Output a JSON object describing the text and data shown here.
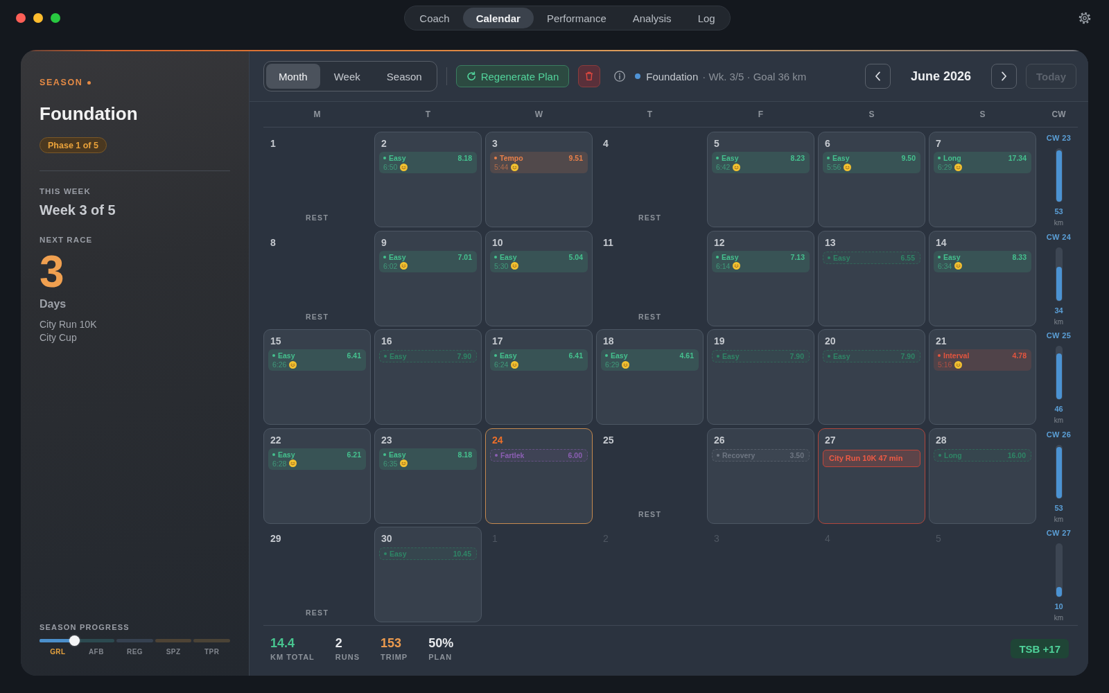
{
  "nav": {
    "tabs": [
      {
        "label": "Coach",
        "selected": false
      },
      {
        "label": "Calendar",
        "selected": true
      },
      {
        "label": "Performance",
        "selected": false
      },
      {
        "label": "Analysis",
        "selected": false
      },
      {
        "label": "Log",
        "selected": false
      }
    ]
  },
  "sidebar": {
    "season_label": "SEASON",
    "season_name": "Foundation",
    "phase_badge": "Phase 1 of 5",
    "this_week_label": "THIS WEEK",
    "this_week": "Week 3 of 5",
    "next_race_label": "NEXT RACE",
    "next_race_count": "3",
    "next_race_unit": "Days",
    "next_race_name": "City Run 10K",
    "next_race_event": "City Cup",
    "season_progress": {
      "title": "SEASON PROGRESS",
      "level": 0.18,
      "phases": [
        {
          "label": "GRL",
          "color": "#4b8fcb",
          "selected": true
        },
        {
          "label": "AFB",
          "color": "#2c4a50",
          "selected": false
        },
        {
          "label": "REG",
          "color": "#364150",
          "selected": false
        },
        {
          "label": "SPZ",
          "color": "#4e4335",
          "selected": false
        },
        {
          "label": "TPR",
          "color": "#4b4336",
          "selected": false
        }
      ]
    }
  },
  "toolbar": {
    "views": [
      {
        "label": "Month",
        "selected": true
      },
      {
        "label": "Week",
        "selected": false
      },
      {
        "label": "Season",
        "selected": false
      }
    ],
    "regenerate_button": "Regenerate Plan",
    "status": {
      "phase": "Foundation",
      "details": "· Wk. 3/5 · Goal 36 km"
    },
    "month_title": "June 2026",
    "today_button": {
      "label": "Today",
      "disabled": true
    }
  },
  "calendar": {
    "weekdays": [
      "M",
      "T",
      "W",
      "T",
      "F",
      "S",
      "S"
    ],
    "week_column_header": "CW",
    "weeks": [
      {
        "label": "CW 23",
        "distance": "53",
        "unit": "km",
        "level": 0.97,
        "days": [
          {
            "date": "1",
            "kind": "rest",
            "rest_label": "REST",
            "today": false
          },
          {
            "date": "2",
            "kind": "workout",
            "today": false,
            "workouts": [
              {
                "kind": "done",
                "type": "Easy",
                "distance": "8.18",
                "pace": "6:50",
                "color": "#45c08e"
              }
            ]
          },
          {
            "date": "3",
            "kind": "workout",
            "today": false,
            "workouts": [
              {
                "kind": "done",
                "type": "Tempo",
                "distance": "9.51",
                "pace": "5:44",
                "color": "#e8804a"
              }
            ]
          },
          {
            "date": "4",
            "kind": "rest",
            "rest_label": "REST",
            "today": false
          },
          {
            "date": "5",
            "kind": "workout",
            "today": false,
            "workouts": [
              {
                "kind": "done",
                "type": "Easy",
                "distance": "8.23",
                "pace": "6:42",
                "color": "#45c08e"
              }
            ]
          },
          {
            "date": "6",
            "kind": "workout",
            "today": false,
            "workouts": [
              {
                "kind": "done",
                "type": "Easy",
                "distance": "9.50",
                "pace": "5:56",
                "color": "#45c08e"
              }
            ]
          },
          {
            "date": "7",
            "kind": "workout",
            "today": false,
            "workouts": [
              {
                "kind": "done",
                "type": "Long",
                "distance": "17.34",
                "pace": "6:29",
                "color": "#45c08e"
              }
            ]
          }
        ]
      },
      {
        "label": "CW 24",
        "distance": "34",
        "unit": "km",
        "level": 0.64,
        "days": [
          {
            "date": "8",
            "kind": "rest",
            "rest_label": "REST",
            "today": false
          },
          {
            "date": "9",
            "kind": "workout",
            "today": false,
            "workouts": [
              {
                "kind": "done",
                "type": "Easy",
                "distance": "7.01",
                "pace": "6:02",
                "color": "#45c08e"
              }
            ]
          },
          {
            "date": "10",
            "kind": "workout",
            "today": false,
            "workouts": [
              {
                "kind": "done",
                "type": "Easy",
                "distance": "5.04",
                "pace": "5:30",
                "color": "#45c08e"
              }
            ]
          },
          {
            "date": "11",
            "kind": "rest",
            "rest_label": "REST",
            "today": false
          },
          {
            "date": "12",
            "kind": "workout",
            "today": false,
            "workouts": [
              {
                "kind": "done",
                "type": "Easy",
                "distance": "7.13",
                "pace": "6:14",
                "color": "#45c08e"
              }
            ]
          },
          {
            "date": "13",
            "kind": "workout",
            "today": false,
            "workouts": [
              {
                "kind": "planned",
                "type": "Easy",
                "distance": "6.55",
                "color": "#2f8566"
              }
            ]
          },
          {
            "date": "14",
            "kind": "workout",
            "today": false,
            "workouts": [
              {
                "kind": "done",
                "type": "Easy",
                "distance": "8.33",
                "pace": "6:34",
                "color": "#45c08e"
              }
            ]
          }
        ]
      },
      {
        "label": "CW 25",
        "distance": "46",
        "unit": "km",
        "level": 0.87,
        "days": [
          {
            "date": "15",
            "kind": "workout",
            "today": false,
            "workouts": [
              {
                "kind": "done",
                "type": "Easy",
                "distance": "6.41",
                "pace": "6:26",
                "color": "#45c08e"
              }
            ]
          },
          {
            "date": "16",
            "kind": "workout",
            "today": false,
            "workouts": [
              {
                "kind": "planned",
                "type": "Easy",
                "distance": "7.90",
                "color": "#2f8566"
              }
            ]
          },
          {
            "date": "17",
            "kind": "workout",
            "today": false,
            "workouts": [
              {
                "kind": "done",
                "type": "Easy",
                "distance": "6.41",
                "pace": "6:24",
                "color": "#45c08e"
              }
            ]
          },
          {
            "date": "18",
            "kind": "workout",
            "today": false,
            "workouts": [
              {
                "kind": "done",
                "type": "Easy",
                "distance": "4.61",
                "pace": "6:29",
                "color": "#45c08e"
              }
            ]
          },
          {
            "date": "19",
            "kind": "workout",
            "today": false,
            "workouts": [
              {
                "kind": "planned",
                "type": "Easy",
                "distance": "7.90",
                "color": "#2f8566"
              }
            ]
          },
          {
            "date": "20",
            "kind": "workout",
            "today": false,
            "workouts": [
              {
                "kind": "planned",
                "type": "Easy",
                "distance": "7.90",
                "color": "#2f8566"
              }
            ]
          },
          {
            "date": "21",
            "kind": "workout",
            "today": false,
            "workouts": [
              {
                "kind": "done",
                "type": "Interval",
                "distance": "4.78",
                "pace": "5:16",
                "color": "#e5553f"
              }
            ]
          }
        ]
      },
      {
        "label": "CW 26",
        "distance": "53",
        "unit": "km",
        "level": 0.97,
        "days": [
          {
            "date": "22",
            "kind": "workout",
            "today": false,
            "workouts": [
              {
                "kind": "done",
                "type": "Easy",
                "distance": "6.21",
                "pace": "6:28",
                "color": "#45c08e"
              }
            ]
          },
          {
            "date": "23",
            "kind": "workout",
            "today": false,
            "workouts": [
              {
                "kind": "done",
                "type": "Easy",
                "distance": "8.18",
                "pace": "6:35",
                "color": "#45c08e"
              }
            ]
          },
          {
            "date": "24",
            "kind": "workout",
            "today": true,
            "workouts": [
              {
                "kind": "planned",
                "type": "Fartlek",
                "distance": "6.00",
                "color": "#8b5fb3"
              }
            ]
          },
          {
            "date": "25",
            "kind": "rest",
            "rest_label": "REST",
            "today": false
          },
          {
            "date": "26",
            "kind": "workout",
            "today": false,
            "workouts": [
              {
                "kind": "planned",
                "type": "Recovery",
                "distance": "3.50",
                "color": "#6e7682"
              }
            ]
          },
          {
            "date": "27",
            "kind": "race",
            "today": false,
            "race": "City Run 10K 47 min"
          },
          {
            "date": "28",
            "kind": "workout",
            "today": false,
            "workouts": [
              {
                "kind": "planned",
                "type": "Long",
                "distance": "16.00",
                "color": "#2f8566"
              }
            ]
          }
        ]
      },
      {
        "label": "CW 27",
        "distance": "10",
        "unit": "km",
        "level": 0.19,
        "days": [
          {
            "date": "29",
            "kind": "rest",
            "rest_label": "REST",
            "today": false
          },
          {
            "date": "30",
            "kind": "workout",
            "today": false,
            "workouts": [
              {
                "kind": "planned",
                "type": "Easy",
                "distance": "10.45",
                "color": "#2f8566"
              }
            ]
          },
          {
            "date": "1",
            "kind": "outside",
            "today": false
          },
          {
            "date": "2",
            "kind": "outside",
            "today": false
          },
          {
            "date": "3",
            "kind": "outside",
            "today": false
          },
          {
            "date": "4",
            "kind": "outside",
            "today": false
          },
          {
            "date": "5",
            "kind": "outside",
            "today": false
          }
        ]
      }
    ]
  },
  "footer": {
    "stats": [
      {
        "value": "14.4",
        "label": "KM TOTAL",
        "color": "#48c48f"
      },
      {
        "value": "2",
        "label": "RUNS",
        "color": "#e8eaed"
      },
      {
        "value": "153",
        "label": "TRIMP",
        "color": "#eb9a4e"
      },
      {
        "value": "50%",
        "label": "PLAN",
        "color": "#e8eaed"
      }
    ],
    "tsb_badge": "TSB +17"
  }
}
